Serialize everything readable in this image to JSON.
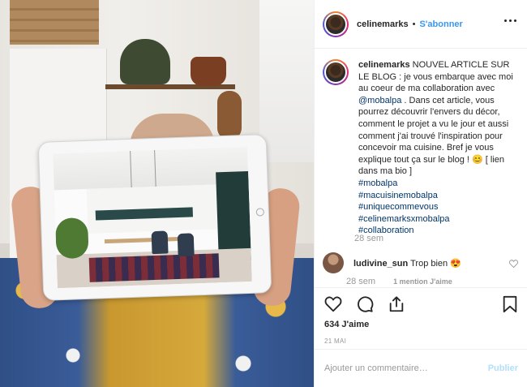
{
  "header": {
    "username": "celinemarks",
    "separator": "•",
    "follow_label": "S'abonner",
    "more_icon": "more-horizontal-icon"
  },
  "caption": {
    "username": "celinemarks",
    "text_1": " NOUVEL ARTICLE SUR LE BLOG : je vous embarque avec moi au coeur de ma collaboration avec ",
    "mention": "@mobalpa",
    "text_2": " . Dans cet article, vous pourrez découvrir l'envers du décor, comment le projet a vu le jour et aussi comment j'ai trouvé l'inspiration pour concevoir ma cuisine. Bref je vous explique tout ça sur le blog ! 😊 [ lien dans ma bio ]",
    "hashtags": [
      "#mobalpa",
      "#macuisinemobalpa",
      "#uniquecommevous",
      "#celinemarksxmobalpa",
      "#collaboration"
    ],
    "time": "28 sem"
  },
  "reply": {
    "username": "ludivine_sun",
    "text": " Trop bien 😍",
    "time": "28 sem",
    "mention_like": "1 mention J'aime",
    "like_icon": "heart-outline-icon"
  },
  "actions": {
    "icons": [
      "heart-outline-icon",
      "comment-icon",
      "share-icon",
      "bookmark-icon"
    ],
    "likes": "634 J'aime",
    "date": "21 MAI"
  },
  "add_comment": {
    "placeholder": "Ajouter un commentaire…",
    "publish_label": "Publier"
  },
  "colors": {
    "link": "#3897f0",
    "hashtag": "#003569",
    "muted": "#999999",
    "publish_disabled": "#b2dffc"
  }
}
